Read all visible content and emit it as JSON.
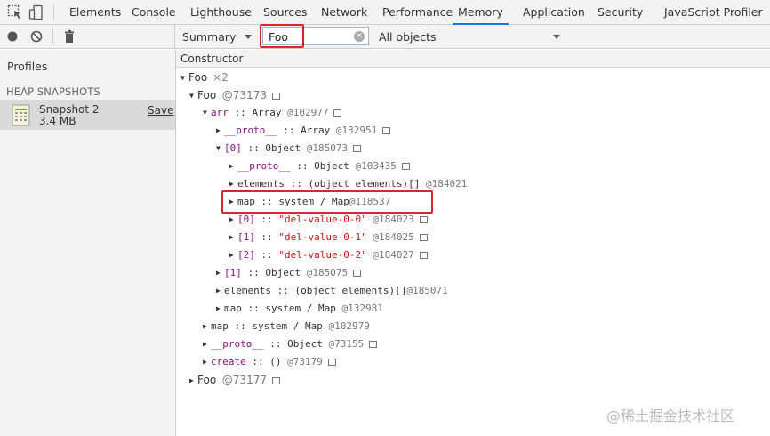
{
  "tabs": [
    "Elements",
    "Console",
    "Lighthouse",
    "Sources",
    "Network",
    "Performance",
    "Memory",
    "Application",
    "Security",
    "JavaScript Profiler"
  ],
  "active_tab": "Memory",
  "toolbar": {
    "view_select": "Summary",
    "filter_value": "Foo",
    "objects_select": "All objects"
  },
  "sidebar": {
    "title": "Profiles",
    "section": "HEAP SNAPSHOTS",
    "snapshot_name": "Snapshot 2",
    "snapshot_size": "3.4 MB",
    "save_label": "Save"
  },
  "table": {
    "column_header": "Constructor",
    "group_name": "Foo",
    "group_count": "×2",
    "rows": [
      {
        "name": "Foo",
        "sep": "",
        "ctor": "",
        "id": "@73173"
      },
      {
        "name": "arr",
        "sep": " :: ",
        "ctor": "Array",
        "id": "@102977"
      },
      {
        "name": "__proto__",
        "sep": " :: ",
        "ctor": "Array",
        "id": "@132951"
      },
      {
        "name": "[0]",
        "sep": " :: ",
        "ctor": "Object",
        "id": "@185073"
      },
      {
        "name": "__proto__",
        "sep": " :: ",
        "ctor": "Object",
        "id": "@103435"
      },
      {
        "name": "elements",
        "sep": " :: ",
        "ctor": "(object elements)[]",
        "id": "@184021"
      },
      {
        "name": "map",
        "sep": " :: ",
        "ctor": "system / Map",
        "id": "@118537"
      },
      {
        "name": "[0]",
        "sep": " :: ",
        "ctor": "\"del-value-0-0\"",
        "id": "@184023"
      },
      {
        "name": "[1]",
        "sep": " :: ",
        "ctor": "\"del-value-0-1\"",
        "id": "@184025"
      },
      {
        "name": "[2]",
        "sep": " :: ",
        "ctor": "\"del-value-0-2\"",
        "id": "@184027"
      },
      {
        "name": "[1]",
        "sep": " :: ",
        "ctor": "Object",
        "id": "@185075"
      },
      {
        "name": "elements",
        "sep": " :: ",
        "ctor": "(object elements)[]",
        "id": "@185071"
      },
      {
        "name": "map",
        "sep": " :: ",
        "ctor": "system / Map",
        "id": "@132981"
      },
      {
        "name": "map",
        "sep": " :: ",
        "ctor": "system / Map",
        "id": "@102979"
      },
      {
        "name": "__proto__",
        "sep": " :: ",
        "ctor": "Object",
        "id": "@73155"
      },
      {
        "name": "create",
        "sep": " :: ",
        "ctor": "()",
        "id": "@73179"
      },
      {
        "name": "Foo",
        "sep": "",
        "ctor": "",
        "id": "@73177"
      }
    ]
  },
  "watermark": "@稀土掘金技术社区",
  "icons": {
    "inspect": "inspect-element-icon",
    "device": "device-toolbar-icon",
    "record": "record-icon",
    "clear": "clear-icon",
    "trash": "trash-icon",
    "snapshot": "heap-snapshot-icon"
  },
  "colors": {
    "highlight": "#d9262c",
    "active_tab_underline": "#1a73e8",
    "property_name": "#881280",
    "string_value": "#c41a16"
  }
}
